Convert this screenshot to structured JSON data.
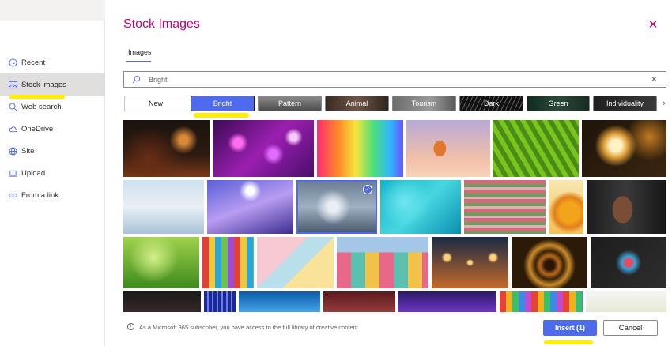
{
  "dialog": {
    "title": "Stock Images",
    "close_icon": "close-icon",
    "tab_label": "Images",
    "accent_color": "#c4007a",
    "primary_color": "#4f6bed"
  },
  "sidebar": {
    "items": [
      {
        "label": "Recent",
        "icon": "clock-icon",
        "active": false
      },
      {
        "label": "Stock images",
        "icon": "image-icon",
        "active": true
      },
      {
        "label": "Web search",
        "icon": "search-icon",
        "active": false
      },
      {
        "label": "OneDrive",
        "icon": "cloud-icon",
        "active": false
      },
      {
        "label": "Site",
        "icon": "globe-icon",
        "active": false
      },
      {
        "label": "Upload",
        "icon": "laptop-icon",
        "active": false
      },
      {
        "label": "From a link",
        "icon": "link-icon",
        "active": false
      }
    ]
  },
  "search": {
    "value": "Bright",
    "placeholder": "Search",
    "clear_icon": "clear-icon"
  },
  "categories": [
    {
      "label": "New",
      "selected": false
    },
    {
      "label": "Bright",
      "selected": true
    },
    {
      "label": "Pattern",
      "selected": false
    },
    {
      "label": "Animal",
      "selected": false
    },
    {
      "label": "Tourism",
      "selected": false
    },
    {
      "label": "Dark",
      "selected": false
    },
    {
      "label": "Green",
      "selected": false
    },
    {
      "label": "Individuality",
      "selected": false
    }
  ],
  "images": [
    {
      "desc": "musician-stage",
      "selected": false
    },
    {
      "desc": "purple-bokeh",
      "selected": false
    },
    {
      "desc": "rainbow-gradient",
      "selected": false
    },
    {
      "desc": "hot-air-balloon",
      "selected": false
    },
    {
      "desc": "green-leaf",
      "selected": false
    },
    {
      "desc": "light-bulb",
      "selected": false
    },
    {
      "desc": "frosted-grass",
      "selected": false
    },
    {
      "desc": "concert-lights",
      "selected": false
    },
    {
      "desc": "cloudy-sky",
      "selected": true
    },
    {
      "desc": "turquoise-water",
      "selected": false
    },
    {
      "desc": "tulip-field",
      "selected": false
    },
    {
      "desc": "sunflower",
      "selected": false
    },
    {
      "desc": "woman-portrait",
      "selected": false
    },
    {
      "desc": "green-sprouts",
      "selected": false
    },
    {
      "desc": "colorful-chairs",
      "selected": false
    },
    {
      "desc": "pastel-geometry",
      "selected": false
    },
    {
      "desc": "colorful-building",
      "selected": false
    },
    {
      "desc": "string-lights",
      "selected": false
    },
    {
      "desc": "light-tunnel",
      "selected": false
    },
    {
      "desc": "makeup-powder",
      "selected": false
    },
    {
      "desc": "dark-shoes",
      "selected": false
    },
    {
      "desc": "blue-tiles",
      "selected": false
    },
    {
      "desc": "blue-architecture",
      "selected": false
    },
    {
      "desc": "red-pattern",
      "selected": false
    },
    {
      "desc": "purple-lights",
      "selected": false
    },
    {
      "desc": "colored-pencils",
      "selected": false
    },
    {
      "desc": "white-bokeh",
      "selected": false
    }
  ],
  "footer": {
    "info_icon": "info-icon",
    "info_text": "As a Microsoft 365 subscriber, you have access to the full library of creative content.",
    "insert_label": "Insert (1)",
    "cancel_label": "Cancel"
  }
}
